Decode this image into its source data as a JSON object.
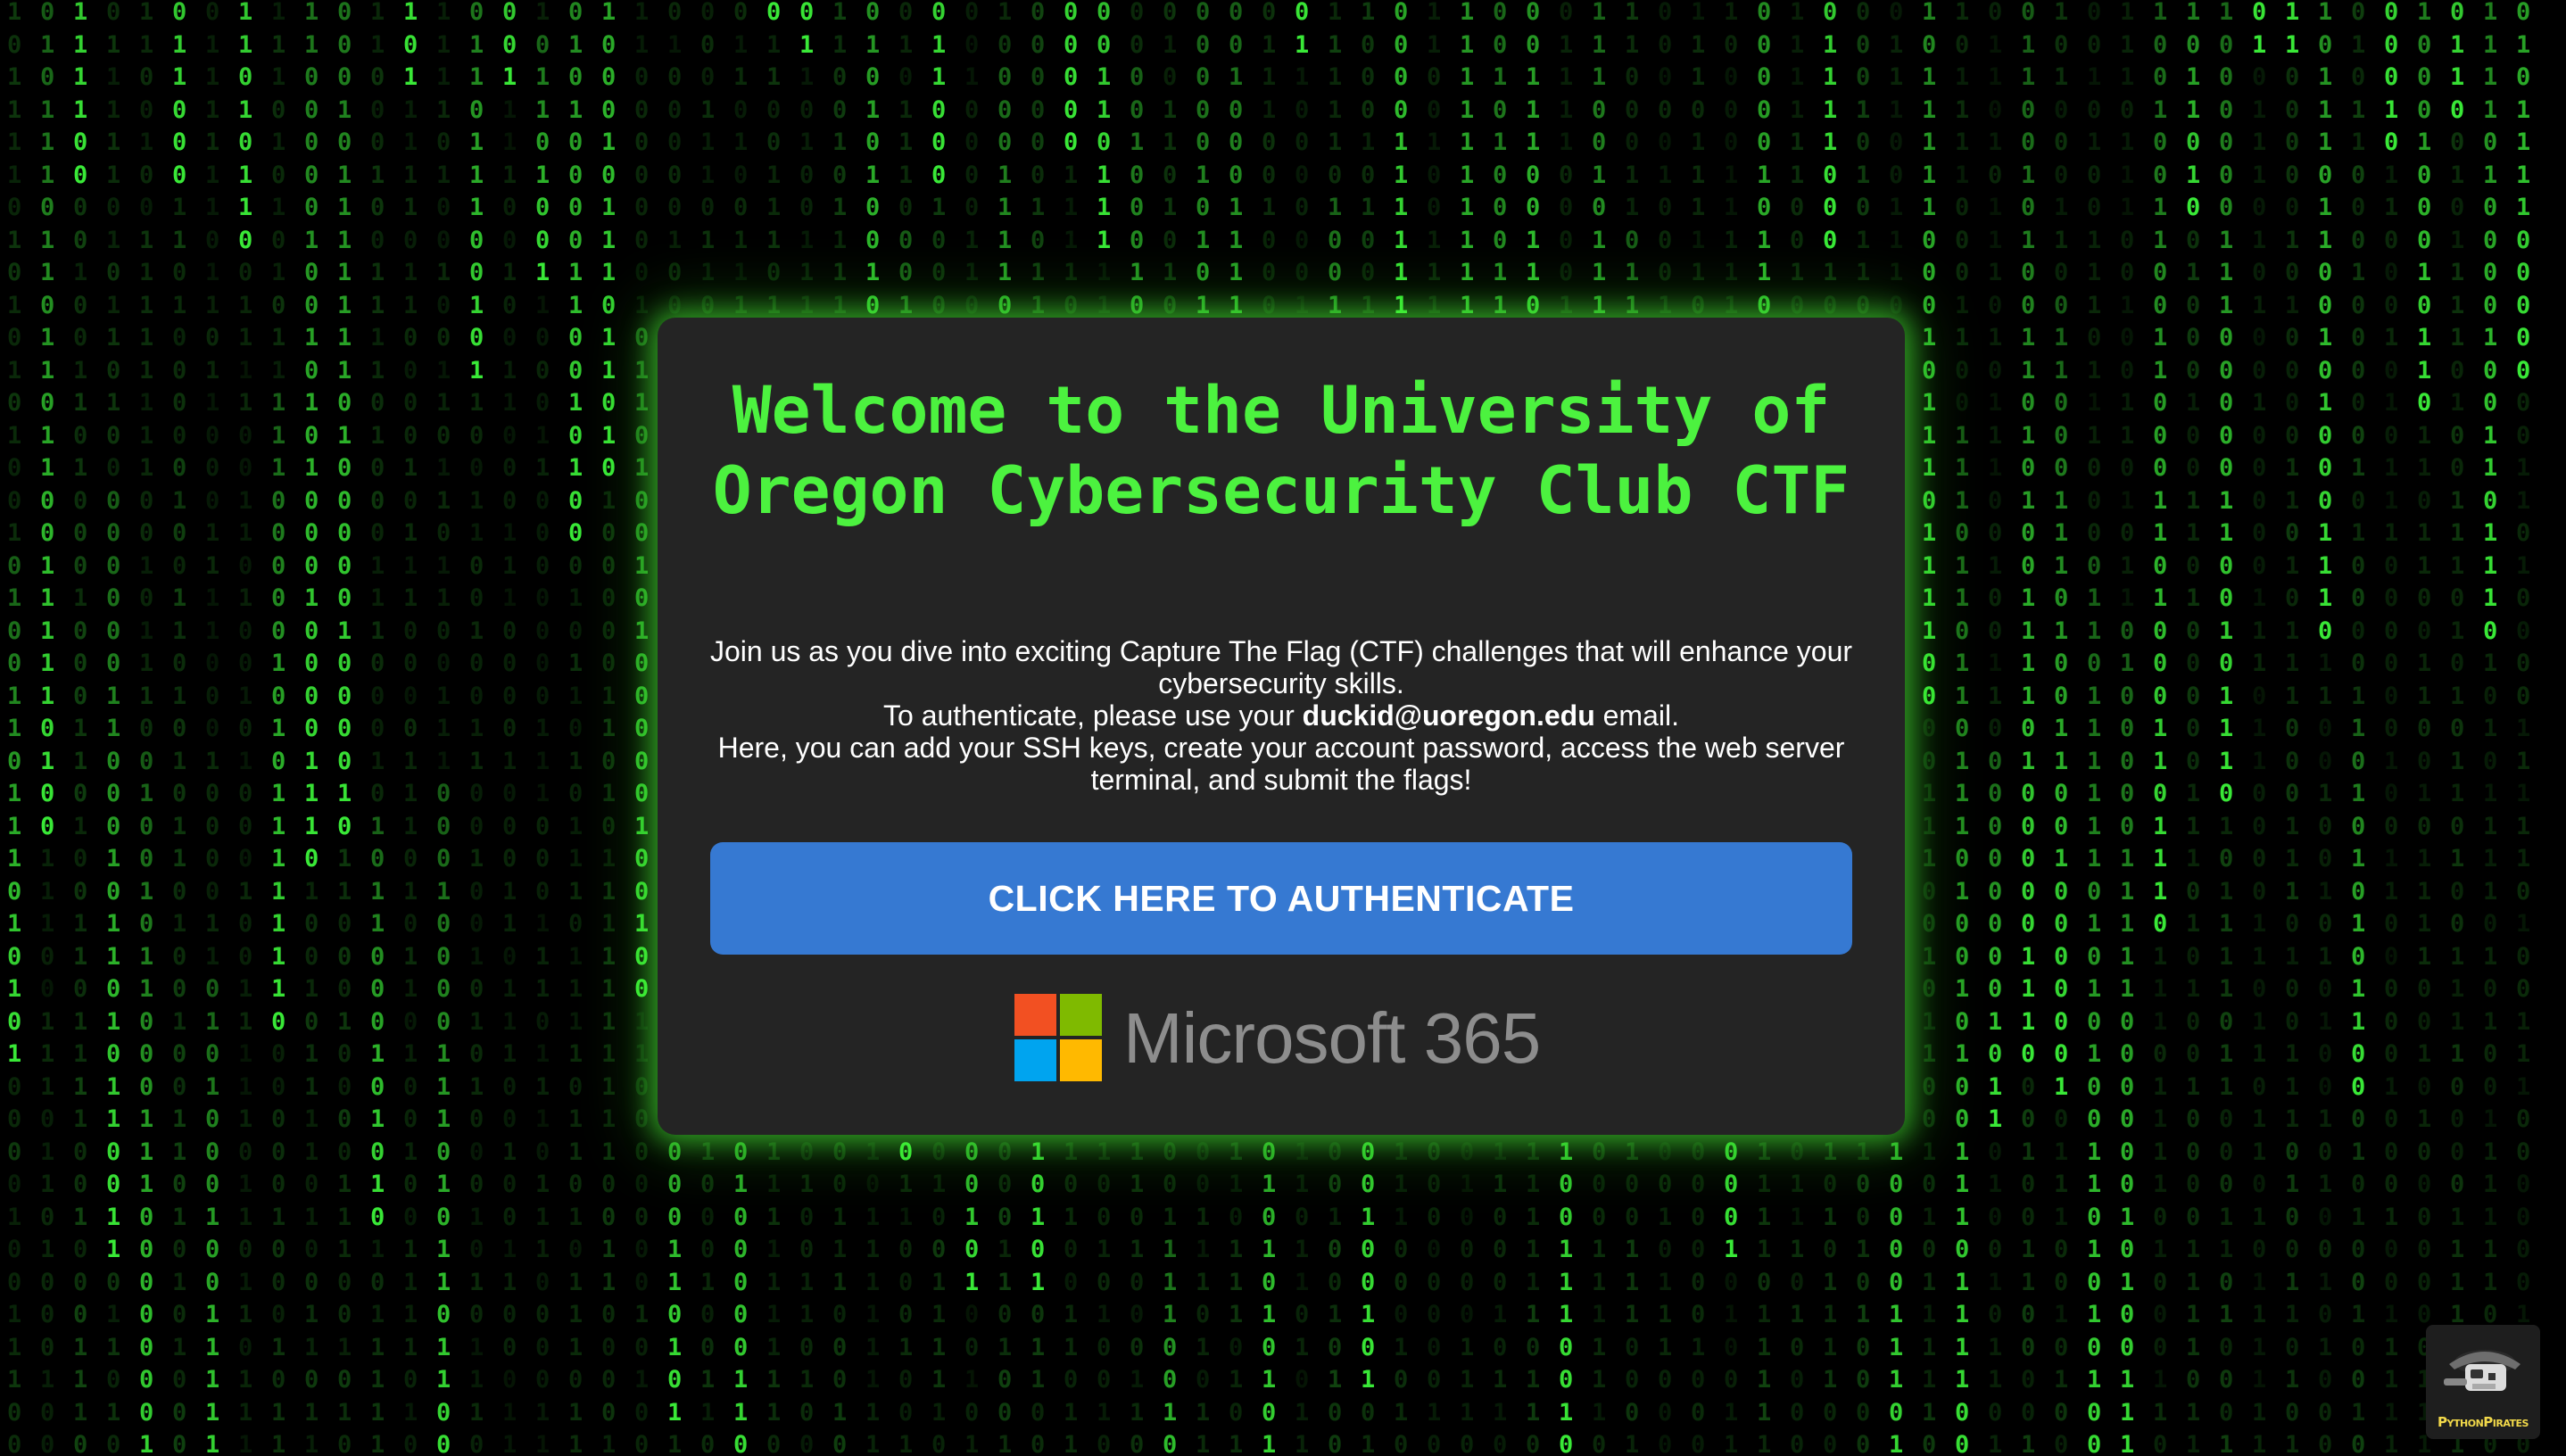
{
  "background": {
    "style": "binary matrix rain",
    "glyphs": [
      "0",
      "1"
    ],
    "color": "#3df53a"
  },
  "card": {
    "title": "Welcome to the University of Oregon Cybersecurity Club CTF",
    "intro": "Join us as you dive into exciting Capture The Flag (CTF) challenges that will enhance your cybersecurity skills.",
    "auth_prefix": "To authenticate, please use your",
    "auth_email": "duckid@uoregon.edu",
    "auth_suffix": "email.",
    "details": "Here, you can add your SSH keys, create your account password, access the web server terminal, and submit the flags!",
    "button_label": "CLICK HERE TO AUTHENTICATE",
    "provider_logo_text": "Microsoft 365",
    "title_color": "#4cf23f",
    "button_color": "#3679d2"
  },
  "corner_badge": {
    "text": "PythonPirates",
    "icon": "pirate-logo-icon"
  }
}
